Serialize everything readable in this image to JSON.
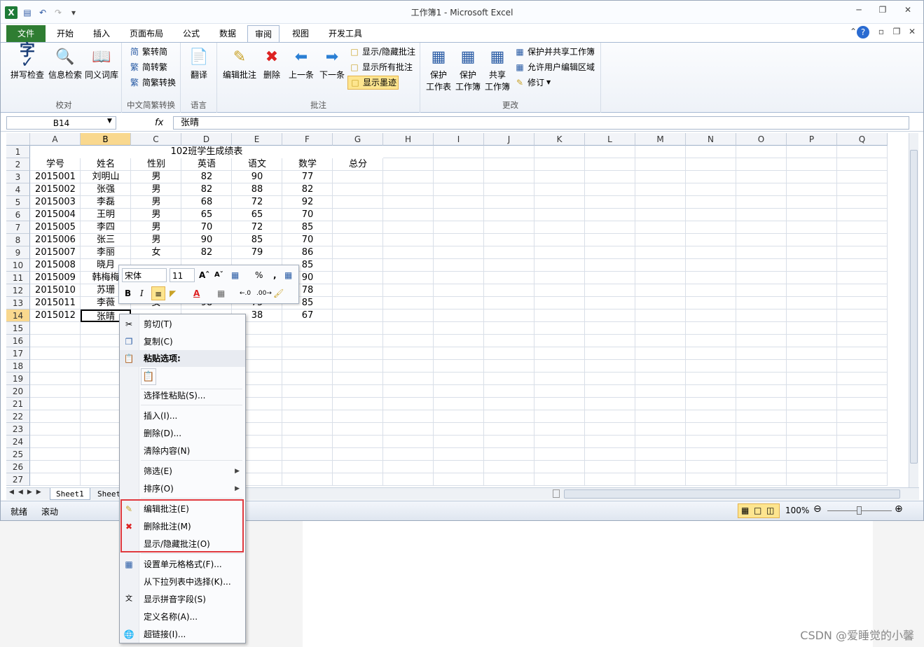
{
  "window": {
    "title": "工作簿1 - Microsoft Excel"
  },
  "tabs": [
    "文件",
    "开始",
    "插入",
    "页面布局",
    "公式",
    "数据",
    "审阅",
    "视图",
    "开发工具"
  ],
  "ribbon": {
    "proofing": {
      "spell": "拼写检查",
      "research": "信息检索",
      "thesaurus": "同义词库",
      "label": "校对"
    },
    "chinese": {
      "to_simplified": "繁转简",
      "to_traditional": "简转繁",
      "convert": "简繁转换",
      "label": "中文简繁转换"
    },
    "language": {
      "translate": "翻译",
      "label": "语言"
    },
    "comments": {
      "edit": "编辑批注",
      "delete": "删除",
      "prev": "上一条",
      "next": "下一条",
      "show_hide": "显示/隐藏批注",
      "show_all": "显示所有批注",
      "show_ink": "显示墨迹",
      "label": "批注"
    },
    "changes": {
      "protect_sheet_1": "保护",
      "protect_sheet_2": "工作表",
      "protect_wb_1": "保护",
      "protect_wb_2": "工作簿",
      "share_wb_1": "共享",
      "share_wb_2": "工作簿",
      "protect_share": "保护并共享工作簿",
      "allow_edit": "允许用户编辑区域",
      "track": "修订",
      "label": "更改"
    }
  },
  "formula_bar": {
    "name_box": "B14",
    "fx": "fx",
    "value": "张晴"
  },
  "columns": [
    "A",
    "B",
    "C",
    "D",
    "E",
    "F",
    "G",
    "H",
    "I",
    "J",
    "K",
    "L",
    "M",
    "N",
    "O",
    "P",
    "Q"
  ],
  "rows": [
    "1",
    "2",
    "3",
    "4",
    "5",
    "6",
    "7",
    "8",
    "9",
    "10",
    "11",
    "12",
    "13",
    "14",
    "15",
    "16",
    "17",
    "18",
    "19",
    "20",
    "21",
    "22",
    "23",
    "24",
    "25",
    "26",
    "27"
  ],
  "sheet": {
    "title": "102班学生成绩表",
    "headers": [
      "学号",
      "姓名",
      "性别",
      "英语",
      "语文",
      "数学",
      "总分"
    ],
    "data": [
      [
        "2015001",
        "刘明山",
        "男",
        "82",
        "90",
        "77"
      ],
      [
        "2015002",
        "张强",
        "男",
        "82",
        "88",
        "82"
      ],
      [
        "2015003",
        "李磊",
        "男",
        "68",
        "72",
        "92"
      ],
      [
        "2015004",
        "王明",
        "男",
        "65",
        "65",
        "70"
      ],
      [
        "2015005",
        "李四",
        "男",
        "70",
        "72",
        "85"
      ],
      [
        "2015006",
        "张三",
        "男",
        "90",
        "85",
        "70"
      ],
      [
        "2015007",
        "李丽",
        "女",
        "82",
        "79",
        "86"
      ],
      [
        "2015008",
        "晓月",
        "",
        "",
        "",
        "85"
      ],
      [
        "2015009",
        "韩梅梅",
        "",
        "",
        "",
        "90"
      ],
      [
        "2015010",
        "苏珊",
        "",
        "",
        "",
        "78"
      ],
      [
        "2015011",
        "李薇",
        "女",
        "98",
        "75",
        "85"
      ],
      [
        "2015012",
        "张晴",
        "",
        "",
        "38",
        "67"
      ]
    ]
  },
  "sheet_tabs": [
    "Sheet1",
    "Sheet"
  ],
  "status": {
    "ready": "就绪",
    "scroll": "滚动",
    "zoom": "100%"
  },
  "mini_toolbar": {
    "font": "宋体",
    "size": "11"
  },
  "context_menu": {
    "cut": "剪切(T)",
    "copy": "复制(C)",
    "paste_options": "粘贴选项:",
    "paste_special": "选择性粘贴(S)...",
    "insert": "插入(I)...",
    "delete": "删除(D)...",
    "clear": "清除内容(N)",
    "filter": "筛选(E)",
    "sort": "排序(O)",
    "edit_comment": "编辑批注(E)",
    "delete_comment": "删除批注(M)",
    "show_hide_comment": "显示/隐藏批注(O)",
    "format_cells": "设置单元格格式(F)...",
    "pick_list": "从下拉列表中选择(K)...",
    "phonetic": "显示拼音字段(S)",
    "define_name": "定义名称(A)...",
    "hyperlink": "超链接(I)..."
  },
  "watermark": "CSDN @爱睡觉的小馨"
}
